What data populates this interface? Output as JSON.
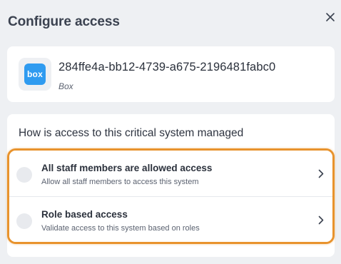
{
  "header": {
    "title": "Configure access",
    "close_icon": "close-icon"
  },
  "system": {
    "logo_text": "box",
    "logo_color": "#2f9bf0",
    "id": "284ffe4a-bb12-4739-a675-2196481fabc0",
    "type": "Box"
  },
  "question": {
    "title": "How is access to this critical system managed",
    "options": [
      {
        "title": "All staff members are allowed access",
        "description": "Allow all staff members to access this system",
        "icon": "chevron-right-icon"
      },
      {
        "title": "Role based access",
        "description": "Validate access to this system based on roles",
        "icon": "chevron-right-icon"
      }
    ]
  },
  "colors": {
    "background": "#eef0f3",
    "card": "#ffffff",
    "highlight": "#e8932d",
    "brand_box": "#2f9bf0"
  }
}
